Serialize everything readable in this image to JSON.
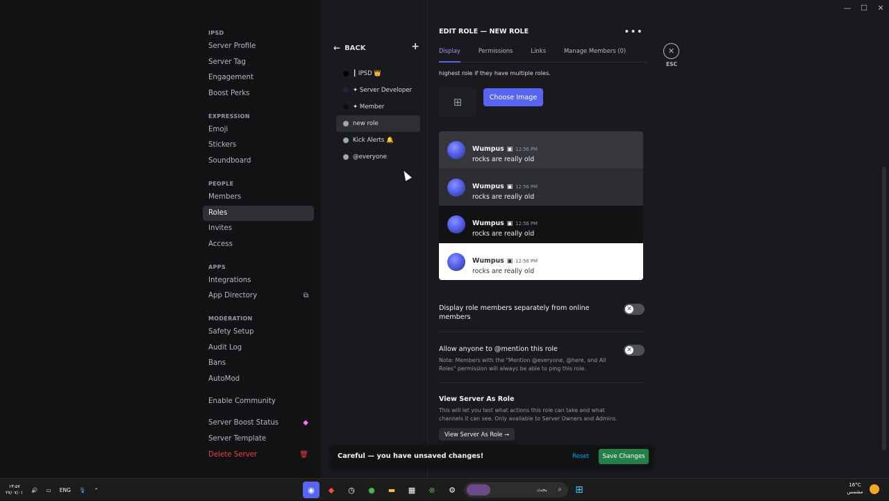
{
  "sidebar": {
    "sections": [
      {
        "category": "IPSD",
        "items": [
          "Server Profile",
          "Server Tag",
          "Engagement",
          "Boost Perks"
        ]
      },
      {
        "category": "EXPRESSION",
        "items": [
          "Emoji",
          "Stickers",
          "Soundboard"
        ]
      },
      {
        "category": "PEOPLE",
        "items": [
          "Members",
          "Roles",
          "Invites",
          "Access"
        ]
      },
      {
        "category": "APPS",
        "items": [
          "Integrations",
          "App Directory"
        ]
      },
      {
        "category": "MODERATION",
        "items": [
          "Safety Setup",
          "Audit Log",
          "Bans",
          "AutoMod"
        ]
      }
    ],
    "extra": [
      "Enable Community",
      "Server Boost Status",
      "Server Template",
      "Delete Server"
    ],
    "active_item": "Roles"
  },
  "roles_panel": {
    "back_label": "BACK",
    "roles": [
      {
        "name": "┃ IPSD 👑",
        "color": "#000000"
      },
      {
        "name": "✦ Server Developer",
        "color": "#2b1a4f"
      },
      {
        "name": "✦ Member",
        "color": "#0f0f10"
      },
      {
        "name": "new role",
        "color": "#99aab5"
      },
      {
        "name": "Kick Alerts 🔔",
        "color": "#99aab5"
      },
      {
        "name": "@everyone",
        "color": "#99aab5"
      }
    ],
    "active_role": "new role"
  },
  "editor": {
    "title": "EDIT ROLE — NEW ROLE",
    "tabs": [
      "Display",
      "Permissions",
      "Links",
      "Manage Members (0)"
    ],
    "active_tab": "Display",
    "esc_label": "ESC",
    "hint": "highest role if they have multiple roles.",
    "choose_image": "Choose Image",
    "preview": {
      "name": "Wumpus",
      "time": "12:56 PM",
      "message": "rocks are really old"
    },
    "settings": {
      "separate_title": "Display role members separately from online members",
      "mention_title": "Allow anyone to @mention this role",
      "mention_note": "Note: Members with the \"Mention @everyone, @here, and All Roles\" permission will always be able to ping this role.",
      "view_title": "View Server As Role",
      "view_note": "This will let you test what actions this role can take and what channels it can see. Only available to Server Owners and Admins.",
      "view_button": "View Server As Role →"
    },
    "unsaved": {
      "message": "Careful — you have unsaved changes!",
      "reset": "Reset",
      "save": "Save Changes"
    }
  },
  "taskbar": {
    "clock_time": "۱۳:۵۷",
    "clock_date": "۲۷/۰۷/۰۱",
    "lang": "ENG",
    "search_text": "بحث",
    "weather_temp": "16°C",
    "weather_desc": "مشمس"
  },
  "colors": {
    "accent": "#5865f2",
    "save_green": "#248046",
    "danger": "#f23f43",
    "link": "#00a8fc"
  }
}
